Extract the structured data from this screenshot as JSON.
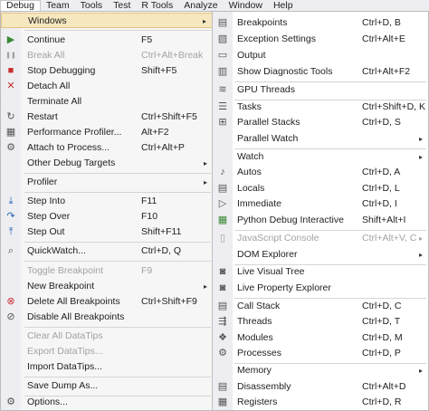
{
  "menubar": {
    "items": [
      "Debug",
      "Team",
      "Tools",
      "Test",
      "R Tools",
      "Analyze",
      "Window",
      "Help"
    ]
  },
  "debug_menu": {
    "windows": "Windows",
    "continue": {
      "label": "Continue",
      "shortcut": "F5"
    },
    "break_all": {
      "label": "Break All",
      "shortcut": "Ctrl+Alt+Break"
    },
    "stop_debugging": {
      "label": "Stop Debugging",
      "shortcut": "Shift+F5"
    },
    "detach_all": {
      "label": "Detach All"
    },
    "terminate_all": {
      "label": "Terminate All"
    },
    "restart": {
      "label": "Restart",
      "shortcut": "Ctrl+Shift+F5"
    },
    "performance_profiler": {
      "label": "Performance Profiler...",
      "shortcut": "Alt+F2"
    },
    "attach_to_process": {
      "label": "Attach to Process...",
      "shortcut": "Ctrl+Alt+P"
    },
    "other_debug_targets": {
      "label": "Other Debug Targets"
    },
    "profiler": {
      "label": "Profiler"
    },
    "step_into": {
      "label": "Step Into",
      "shortcut": "F11"
    },
    "step_over": {
      "label": "Step Over",
      "shortcut": "F10"
    },
    "step_out": {
      "label": "Step Out",
      "shortcut": "Shift+F11"
    },
    "quickwatch": {
      "label": "QuickWatch...",
      "shortcut": "Ctrl+D, Q"
    },
    "toggle_breakpoint": {
      "label": "Toggle Breakpoint",
      "shortcut": "F9"
    },
    "new_breakpoint": {
      "label": "New Breakpoint"
    },
    "delete_all_breakpoints": {
      "label": "Delete All Breakpoints",
      "shortcut": "Ctrl+Shift+F9"
    },
    "disable_all_breakpoints": {
      "label": "Disable All Breakpoints"
    },
    "clear_all_datatips": {
      "label": "Clear All DataTips"
    },
    "export_datatips": {
      "label": "Export DataTips..."
    },
    "import_datatips": {
      "label": "Import DataTips..."
    },
    "save_dump_as": {
      "label": "Save Dump As..."
    },
    "options": {
      "label": "Options..."
    }
  },
  "windows_menu": {
    "breakpoints": {
      "label": "Breakpoints",
      "shortcut": "Ctrl+D, B"
    },
    "exception_settings": {
      "label": "Exception Settings",
      "shortcut": "Ctrl+Alt+E"
    },
    "output": {
      "label": "Output"
    },
    "show_diagnostic_tools": {
      "label": "Show Diagnostic Tools",
      "shortcut": "Ctrl+Alt+F2"
    },
    "gpu_threads": {
      "label": "GPU Threads"
    },
    "tasks": {
      "label": "Tasks",
      "shortcut": "Ctrl+Shift+D, K"
    },
    "parallel_stacks": {
      "label": "Parallel Stacks",
      "shortcut": "Ctrl+D, S"
    },
    "parallel_watch": {
      "label": "Parallel Watch"
    },
    "watch": {
      "label": "Watch"
    },
    "autos": {
      "label": "Autos",
      "shortcut": "Ctrl+D, A"
    },
    "locals": {
      "label": "Locals",
      "shortcut": "Ctrl+D, L"
    },
    "immediate": {
      "label": "Immediate",
      "shortcut": "Ctrl+D, I"
    },
    "python_debug_interactive": {
      "label": "Python Debug Interactive",
      "shortcut": "Shift+Alt+I"
    },
    "javascript_console": {
      "label": "JavaScript Console",
      "shortcut": "Ctrl+Alt+V, C"
    },
    "dom_explorer": {
      "label": "DOM Explorer"
    },
    "live_visual_tree": {
      "label": "Live Visual Tree"
    },
    "live_property_explorer": {
      "label": "Live Property Explorer"
    },
    "call_stack": {
      "label": "Call Stack",
      "shortcut": "Ctrl+D, C"
    },
    "threads": {
      "label": "Threads",
      "shortcut": "Ctrl+D, T"
    },
    "modules": {
      "label": "Modules",
      "shortcut": "Ctrl+D, M"
    },
    "processes": {
      "label": "Processes",
      "shortcut": "Ctrl+D, P"
    },
    "memory": {
      "label": "Memory"
    },
    "disassembly": {
      "label": "Disassembly",
      "shortcut": "Ctrl+Alt+D"
    },
    "registers": {
      "label": "Registers",
      "shortcut": "Ctrl+D, R"
    }
  },
  "icons": {
    "arrow": "▸",
    "continue": "▶",
    "break_all": "❚❚",
    "stop": "■",
    "detach": "✕",
    "restart": "↻",
    "profiler": "▦",
    "attach": "⚙",
    "step_into": "⤓",
    "step_over": "↷",
    "step_out": "⤒",
    "quickwatch": "⌕",
    "breakpoint_new": "●",
    "delete_breakpoints": "⊗",
    "disable_breakpoints": "⊘",
    "save": "▣",
    "options": "⚙",
    "win_breakpoints": "▤",
    "win_exception": "▧",
    "win_output": "▭",
    "win_diagnostic": "▥",
    "win_gpu": "≋",
    "win_tasks": "☰",
    "win_parallel_stacks": "⊞",
    "win_autos": "♪",
    "win_locals": "▤",
    "win_immediate": "▷",
    "win_python": "▦",
    "win_js": "▯",
    "win_live_tree": "◙",
    "win_live_prop": "◙",
    "win_call_stack": "▤",
    "win_threads": "⇶",
    "win_modules": "❖",
    "win_processes": "⚙",
    "win_disassembly": "▤",
    "win_registers": "▦"
  },
  "colors": {
    "menu_bg": "#f6f6f6",
    "gutter_bg": "#eeeef2",
    "highlight": "#f7e7bf",
    "disabled_text": "#a2a2a2",
    "accent_blue": "#1e5fb0"
  }
}
